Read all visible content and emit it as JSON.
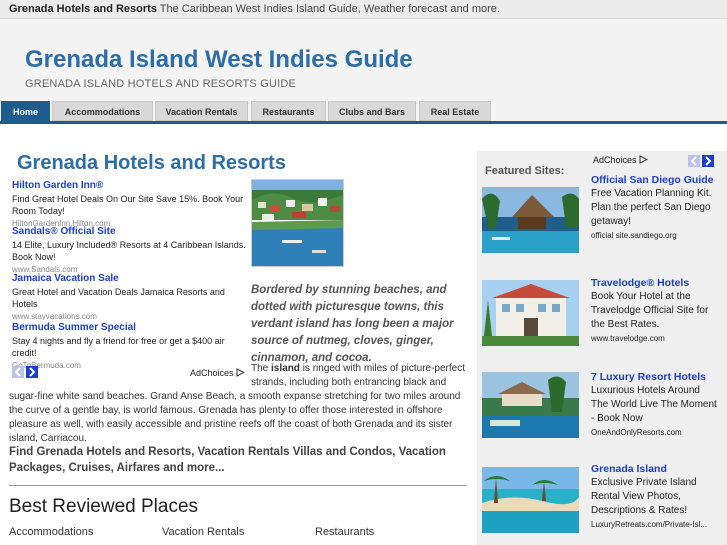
{
  "topbar": {
    "site_name": "Grenada Hotels and Resorts",
    "tagline": " The Caribbean West Indies Island Guide, Weather forecast and more."
  },
  "header": {
    "title": "Grenada Island West Indies Guide",
    "subtitle": "GRENADA ISLAND HOTELS AND RESORTS GUIDE"
  },
  "nav": {
    "items": [
      {
        "label": "Home",
        "active": true
      },
      {
        "label": "Accommodations"
      },
      {
        "label": "Vacation Rentals"
      },
      {
        "label": "Restaurants"
      },
      {
        "label": "Clubs and Bars"
      },
      {
        "label": "Real Estate"
      }
    ]
  },
  "main": {
    "title": "Grenada Hotels and Resorts",
    "ads": [
      {
        "title": "Hilton Garden Inn®",
        "text": "Find Great Hotel Deals On Our Site Save 15%. Book Your Room Today!",
        "url": "HiltonGardenInn.Hilton.com"
      },
      {
        "title": "Sandals® Official Site",
        "text": "14 Elite, Luxury Included® Resorts at 4 Caribbean Islands. Book Now!",
        "url": "www.Sandals.com"
      },
      {
        "title": "Jamaica Vacation Sale",
        "text": "Great Hotel and Vacation Deals Jamaica Resorts and Hotels",
        "url": "www.stayvacations.com"
      },
      {
        "title": "Bermuda Summer Special",
        "text": "Stay 4 nights and fly a friend for free or get a $400 air credit!",
        "url": "GoToBermuda.com"
      }
    ],
    "adchoices": "AdChoices",
    "italic_intro": "Bordered by stunning beaches, and dotted with picturesque towns, this verdant island has long been a major source of nutmeg, cloves, ginger, cinnamon, and cocoa.",
    "body_pre": "The ",
    "body_bold": "island",
    "body_post": " is ringed with miles of picture-perfect strands, including both entrancing black and",
    "body_full": "sugar-fine white sand beaches. Grand Anse Beach, a smooth expanse stretching for two miles around the curve of a gentle bay, is world famous. Grenada has plenty to offer those interested in offshore pleasure as well, with easily accessible and pristine reefs off the coast of both Grenada and its sister island, Carriacou.",
    "find_text": "Find Grenada Hotels and Resorts, Vacation Rentals Villas and Condos, Vacation Packages, Cruises, Airfares and more...",
    "best_title": "Best Reviewed Places",
    "categories": [
      "Accommodations",
      "Vacation Rentals",
      "Restaurants"
    ]
  },
  "sidebar": {
    "featured_label": "Featured Sites:",
    "adchoices": "AdChoices",
    "ads": [
      {
        "title": "Official San Diego Guide",
        "text": "Free Vacation Planning Kit. Plan the perfect San Diego getaway!",
        "url": "official site.sandiego.org"
      },
      {
        "title": "Travelodge® Hotels",
        "text": "Book Your Hotel at the Travelodge Official Site for the Best Rates.",
        "url": "www.travelodge.com"
      },
      {
        "title": "7 Luxury Resort Hotels",
        "text": "Luxurious Hotels Around The World Live The Moment - Book Now",
        "url": "OneAndOnlyResorts.com"
      },
      {
        "title": "Grenada Island",
        "text": "Exclusive Private Island Rental View Photos, Descriptions & Rates!",
        "url": "LuxuryRetreats.com/Private-Isl..."
      }
    ]
  },
  "colors": {
    "brand_blue": "#2b6ea8",
    "nav_active": "#1d5c8e",
    "ad_link": "#1a3fd0"
  }
}
